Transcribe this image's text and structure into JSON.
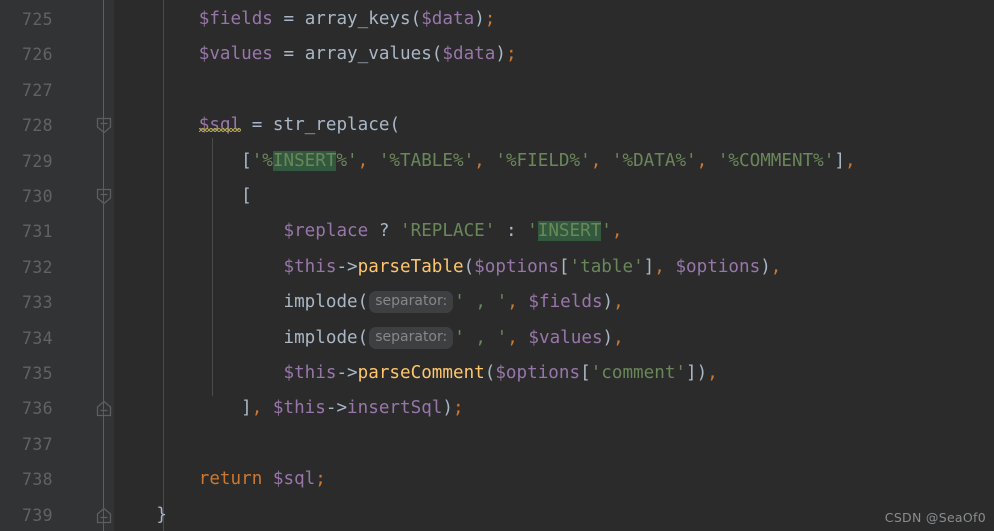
{
  "editor": {
    "theme_name": "darcula",
    "colors": {
      "editor_background": "#2b2b2b",
      "gutter_background": "#313335",
      "line_number": "#606366",
      "default_text": "#a9b7c6",
      "variable": "#9876aa",
      "function": "#ffc66d",
      "string": "#6a8759",
      "keyword": "#cc7832",
      "occurrence_highlight": "#32593d",
      "indent_guide": "#4b4b4b",
      "fold_line": "#5c5f61",
      "inlay_hint_background": "#3d3f41",
      "inlay_hint_text": "#878787",
      "warning_squiggle": "#a9a14b"
    },
    "line_numbers": [
      "725",
      "726",
      "727",
      "728",
      "729",
      "730",
      "731",
      "732",
      "733",
      "734",
      "735",
      "736",
      "737",
      "738",
      "739"
    ],
    "fold_markers": [
      {
        "line": "728",
        "direction": "down",
        "state": "expanded"
      },
      {
        "line": "730",
        "direction": "down",
        "state": "expanded"
      },
      {
        "line": "736",
        "direction": "up",
        "state": "expanded"
      },
      {
        "line": "739",
        "direction": "up",
        "state": "expanded"
      }
    ],
    "lines": [
      {
        "number": "725",
        "text": "        $fields = array_keys($data);"
      },
      {
        "number": "726",
        "text": "        $values = array_values($data);"
      },
      {
        "number": "727",
        "text": ""
      },
      {
        "number": "728",
        "text": "        $sql = str_replace("
      },
      {
        "number": "729",
        "text": "            ['%INSERT%', '%TABLE%', '%FIELD%', '%DATA%', '%COMMENT%'],"
      },
      {
        "number": "730",
        "text": "            ["
      },
      {
        "number": "731",
        "text": "                $replace ? 'REPLACE' : 'INSERT',"
      },
      {
        "number": "732",
        "text": "                $this->parseTable($options['table'], $options),"
      },
      {
        "number": "733",
        "text": "                implode( separator: ' , ', $fields),"
      },
      {
        "number": "734",
        "text": "                implode( separator: ' , ', $values),"
      },
      {
        "number": "735",
        "text": "                $this->parseComment($options['comment']),"
      },
      {
        "number": "736",
        "text": "            ], $this->insertSql);"
      },
      {
        "number": "737",
        "text": ""
      },
      {
        "number": "738",
        "text": "        return $sql;"
      },
      {
        "number": "739",
        "text": "    }"
      }
    ],
    "inlay_hints": [
      {
        "line": "733",
        "label": "separator:"
      },
      {
        "line": "734",
        "label": "separator:"
      }
    ],
    "highlighted_occurrences": [
      {
        "line": "729",
        "text": "INSERT"
      },
      {
        "line": "731",
        "text": "INSERT"
      }
    ],
    "tokens": {
      "l725": [
        {
          "t": "        ",
          "c": "plain"
        },
        {
          "t": "$fields",
          "c": "var"
        },
        {
          "t": " = ",
          "c": "plain"
        },
        {
          "t": "array_keys",
          "c": "call"
        },
        {
          "t": "(",
          "c": "plain"
        },
        {
          "t": "$data",
          "c": "var"
        },
        {
          "t": ")",
          "c": "plain"
        },
        {
          "t": ";",
          "c": "semi"
        }
      ],
      "l726": [
        {
          "t": "        ",
          "c": "plain"
        },
        {
          "t": "$values",
          "c": "var"
        },
        {
          "t": " = ",
          "c": "plain"
        },
        {
          "t": "array_values",
          "c": "call"
        },
        {
          "t": "(",
          "c": "plain"
        },
        {
          "t": "$data",
          "c": "var"
        },
        {
          "t": ")",
          "c": "plain"
        },
        {
          "t": ";",
          "c": "semi"
        }
      ],
      "l728": [
        {
          "t": "        ",
          "c": "plain"
        },
        {
          "t": "$sql",
          "c": "var",
          "squiggle": true
        },
        {
          "t": " = ",
          "c": "plain"
        },
        {
          "t": "str_replace",
          "c": "call"
        },
        {
          "t": "(",
          "c": "plain"
        }
      ],
      "l729": [
        {
          "t": "            ",
          "c": "plain"
        },
        {
          "t": "[",
          "c": "plain"
        },
        {
          "t": "'%",
          "c": "str"
        },
        {
          "t": "INSERT",
          "c": "str",
          "hl": true
        },
        {
          "t": "%'",
          "c": "str"
        },
        {
          "t": ",",
          "c": "comma"
        },
        {
          "t": " ",
          "c": "plain"
        },
        {
          "t": "'%TABLE%'",
          "c": "str"
        },
        {
          "t": ",",
          "c": "comma"
        },
        {
          "t": " ",
          "c": "plain"
        },
        {
          "t": "'%FIELD%'",
          "c": "str"
        },
        {
          "t": ",",
          "c": "comma"
        },
        {
          "t": " ",
          "c": "plain"
        },
        {
          "t": "'%DATA%'",
          "c": "str"
        },
        {
          "t": ",",
          "c": "comma"
        },
        {
          "t": " ",
          "c": "plain"
        },
        {
          "t": "'%COMMENT%'",
          "c": "str"
        },
        {
          "t": "]",
          "c": "plain"
        },
        {
          "t": ",",
          "c": "comma"
        }
      ],
      "l730": [
        {
          "t": "            ",
          "c": "plain"
        },
        {
          "t": "[",
          "c": "plain"
        }
      ],
      "l731": [
        {
          "t": "                ",
          "c": "plain"
        },
        {
          "t": "$replace",
          "c": "var"
        },
        {
          "t": " ",
          "c": "plain"
        },
        {
          "t": "?",
          "c": "plain"
        },
        {
          "t": " ",
          "c": "plain"
        },
        {
          "t": "'REPLACE'",
          "c": "str"
        },
        {
          "t": " ",
          "c": "plain"
        },
        {
          "t": ":",
          "c": "plain"
        },
        {
          "t": " ",
          "c": "plain"
        },
        {
          "t": "'",
          "c": "str"
        },
        {
          "t": "INSERT",
          "c": "str",
          "hl": true
        },
        {
          "t": "'",
          "c": "str"
        },
        {
          "t": ",",
          "c": "comma"
        }
      ],
      "l732": [
        {
          "t": "                ",
          "c": "plain"
        },
        {
          "t": "$this",
          "c": "var"
        },
        {
          "t": "->",
          "c": "plain"
        },
        {
          "t": "parseTable",
          "c": "fn"
        },
        {
          "t": "(",
          "c": "plain"
        },
        {
          "t": "$options",
          "c": "var"
        },
        {
          "t": "[",
          "c": "plain"
        },
        {
          "t": "'table'",
          "c": "str"
        },
        {
          "t": "]",
          "c": "plain"
        },
        {
          "t": ",",
          "c": "comma"
        },
        {
          "t": " ",
          "c": "plain"
        },
        {
          "t": "$options",
          "c": "var"
        },
        {
          "t": ")",
          "c": "plain"
        },
        {
          "t": ",",
          "c": "comma"
        }
      ],
      "l733": [
        {
          "t": "                ",
          "c": "plain"
        },
        {
          "t": "implode",
          "c": "call"
        },
        {
          "t": "(",
          "c": "plain"
        },
        {
          "t": "separator:",
          "c": "hint"
        },
        {
          "t": "' , '",
          "c": "str"
        },
        {
          "t": ",",
          "c": "comma"
        },
        {
          "t": " ",
          "c": "plain"
        },
        {
          "t": "$fields",
          "c": "var"
        },
        {
          "t": ")",
          "c": "plain"
        },
        {
          "t": ",",
          "c": "comma"
        }
      ],
      "l734": [
        {
          "t": "                ",
          "c": "plain"
        },
        {
          "t": "implode",
          "c": "call"
        },
        {
          "t": "(",
          "c": "plain"
        },
        {
          "t": "separator:",
          "c": "hint"
        },
        {
          "t": "' , '",
          "c": "str"
        },
        {
          "t": ",",
          "c": "comma"
        },
        {
          "t": " ",
          "c": "plain"
        },
        {
          "t": "$values",
          "c": "var"
        },
        {
          "t": ")",
          "c": "plain"
        },
        {
          "t": ",",
          "c": "comma"
        }
      ],
      "l735": [
        {
          "t": "                ",
          "c": "plain"
        },
        {
          "t": "$this",
          "c": "var"
        },
        {
          "t": "->",
          "c": "plain"
        },
        {
          "t": "parseComment",
          "c": "fn"
        },
        {
          "t": "(",
          "c": "plain"
        },
        {
          "t": "$options",
          "c": "var"
        },
        {
          "t": "[",
          "c": "plain"
        },
        {
          "t": "'comment'",
          "c": "str"
        },
        {
          "t": "]",
          "c": "plain"
        },
        {
          "t": ")",
          "c": "plain"
        },
        {
          "t": ",",
          "c": "comma"
        }
      ],
      "l736": [
        {
          "t": "            ",
          "c": "plain"
        },
        {
          "t": "]",
          "c": "plain"
        },
        {
          "t": ",",
          "c": "comma"
        },
        {
          "t": " ",
          "c": "plain"
        },
        {
          "t": "$this",
          "c": "var"
        },
        {
          "t": "->",
          "c": "plain"
        },
        {
          "t": "insertSql",
          "c": "var"
        },
        {
          "t": ")",
          "c": "plain"
        },
        {
          "t": ";",
          "c": "semi"
        }
      ],
      "l738": [
        {
          "t": "        ",
          "c": "plain"
        },
        {
          "t": "return",
          "c": "kw"
        },
        {
          "t": " ",
          "c": "plain"
        },
        {
          "t": "$sql",
          "c": "var"
        },
        {
          "t": ";",
          "c": "semi"
        }
      ],
      "l739": [
        {
          "t": "    ",
          "c": "plain"
        },
        {
          "t": "}",
          "c": "plain"
        }
      ]
    }
  },
  "watermark": {
    "text": "CSDN @SeaOf0"
  }
}
